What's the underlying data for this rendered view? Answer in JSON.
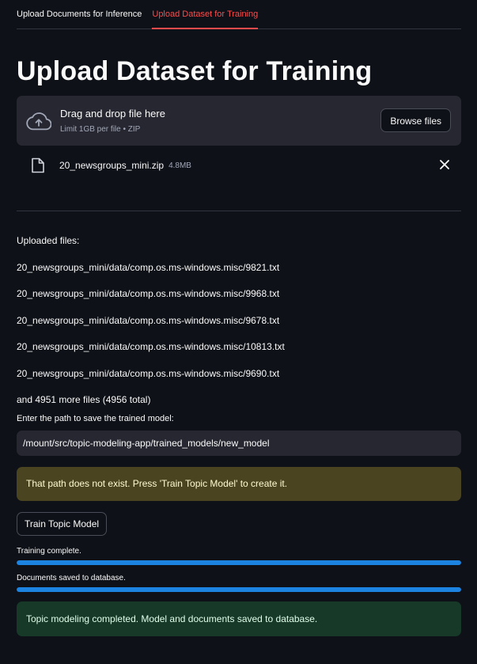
{
  "tabs": [
    {
      "label": "Upload Documents for Inference",
      "active": false
    },
    {
      "label": "Upload Dataset for Training",
      "active": true
    }
  ],
  "page_title": "Upload Dataset for Training",
  "uploader": {
    "main_text": "Drag and drop file here",
    "limit_text": "Limit 1GB per file • ZIP",
    "browse_label": "Browse files",
    "icon": "cloud-upload-icon"
  },
  "file": {
    "name": "20_newsgroups_mini.zip",
    "size": "4.8MB",
    "icon": "file-icon"
  },
  "uploaded": {
    "label": "Uploaded files:",
    "files": [
      "20_newsgroups_mini/data/comp.os.ms-windows.misc/9821.txt",
      "20_newsgroups_mini/data/comp.os.ms-windows.misc/9968.txt",
      "20_newsgroups_mini/data/comp.os.ms-windows.misc/9678.txt",
      "20_newsgroups_mini/data/comp.os.ms-windows.misc/10813.txt",
      "20_newsgroups_mini/data/comp.os.ms-windows.misc/9690.txt"
    ],
    "more": "and 4951 more files (4956 total)"
  },
  "model_path": {
    "label": "Enter the path to save the trained model:",
    "value": "/mount/src/topic-modeling-app/trained_models/new_model"
  },
  "warning": "That path does not exist. Press 'Train Topic Model' to create it.",
  "train_button": "Train Topic Model",
  "progress": [
    {
      "label": "Training complete.",
      "value": 1.0
    },
    {
      "label": "Documents saved to database.",
      "value": 1.0
    }
  ],
  "success": "Topic modeling completed. Model and documents saved to database.",
  "colors": {
    "background": "#0e1117",
    "accent": "#ff4b4b",
    "progress": "#1c83e1",
    "warning_bg": "#4a4420",
    "success_bg": "#173928"
  }
}
